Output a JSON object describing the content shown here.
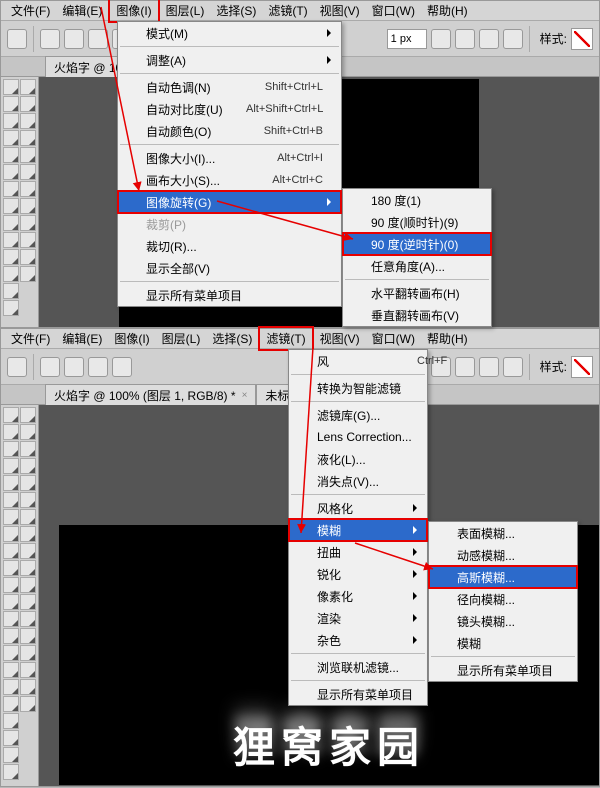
{
  "top": {
    "menubar": [
      "文件(F)",
      "编辑(E)",
      "图像(I)",
      "图层(L)",
      "选择(S)",
      "滤镜(T)",
      "视图(V)",
      "窗口(W)",
      "帮助(H)"
    ],
    "boxed_index": 2,
    "px_value": "1 px",
    "style_label": "样式:",
    "tab": "火焰字 @ 100",
    "menu_image": {
      "rows": [
        {
          "l": "模式(M)",
          "sub": true
        },
        {
          "sep": true
        },
        {
          "l": "调整(A)",
          "sub": true
        },
        {
          "sep": true
        },
        {
          "l": "自动色调(N)",
          "sc": "Shift+Ctrl+L"
        },
        {
          "l": "自动对比度(U)",
          "sc": "Alt+Shift+Ctrl+L"
        },
        {
          "l": "自动颜色(O)",
          "sc": "Shift+Ctrl+B"
        },
        {
          "sep": true
        },
        {
          "l": "图像大小(I)...",
          "sc": "Alt+Ctrl+I"
        },
        {
          "l": "画布大小(S)...",
          "sc": "Alt+Ctrl+C"
        },
        {
          "l": "图像旋转(G)",
          "sub": true,
          "hl": true,
          "box": true
        },
        {
          "l": "裁剪(P)",
          "dis": true
        },
        {
          "l": "裁切(R)...",
          "dis": false
        },
        {
          "l": "显示全部(V)"
        },
        {
          "sep": true
        },
        {
          "l": "显示所有菜单项目"
        }
      ]
    },
    "menu_rotate": {
      "rows": [
        {
          "l": "180 度(1)"
        },
        {
          "l": "90 度(顺时针)(9)"
        },
        {
          "l": "90 度(逆时针)(0)",
          "hl": true,
          "box": true
        },
        {
          "l": "任意角度(A)..."
        },
        {
          "sep": true
        },
        {
          "l": "水平翻转画布(H)"
        },
        {
          "l": "垂直翻转画布(V)"
        }
      ]
    }
  },
  "bottom": {
    "menubar": [
      "文件(F)",
      "编辑(E)",
      "图像(I)",
      "图层(L)",
      "选择(S)",
      "滤镜(T)",
      "视图(V)",
      "窗口(W)",
      "帮助(H)"
    ],
    "boxed_index": 5,
    "px_value": "1 px",
    "style_label": "样式:",
    "tabs": [
      "火焰字 @ 100% (图层 1, RGB/8) *",
      "未标..."
    ],
    "canvas_text": "狸窝家园",
    "menu_filter": {
      "rows": [
        {
          "l": "风",
          "sc": "Ctrl+F"
        },
        {
          "sep": true
        },
        {
          "l": "转换为智能滤镜"
        },
        {
          "sep": true
        },
        {
          "l": "滤镜库(G)..."
        },
        {
          "l": "Lens Correction..."
        },
        {
          "l": "液化(L)..."
        },
        {
          "l": "消失点(V)..."
        },
        {
          "sep": true
        },
        {
          "l": "风格化",
          "sub": true
        },
        {
          "l": "模糊",
          "sub": true,
          "hl": true,
          "box": true
        },
        {
          "l": "扭曲",
          "sub": true
        },
        {
          "l": "锐化",
          "sub": true
        },
        {
          "l": "像素化",
          "sub": true
        },
        {
          "l": "渲染",
          "sub": true
        },
        {
          "l": "杂色",
          "sub": true
        },
        {
          "sep": true
        },
        {
          "l": "浏览联机滤镜..."
        },
        {
          "sep": true
        },
        {
          "l": "显示所有菜单项目"
        }
      ]
    },
    "menu_blur": {
      "rows": [
        {
          "l": "表面模糊..."
        },
        {
          "l": "动感模糊..."
        },
        {
          "l": "高斯模糊...",
          "hl": true,
          "box": true
        },
        {
          "l": "径向模糊..."
        },
        {
          "l": "镜头模糊..."
        },
        {
          "l": "模糊"
        },
        {
          "sep": true
        },
        {
          "l": "显示所有菜单项目"
        }
      ]
    }
  }
}
